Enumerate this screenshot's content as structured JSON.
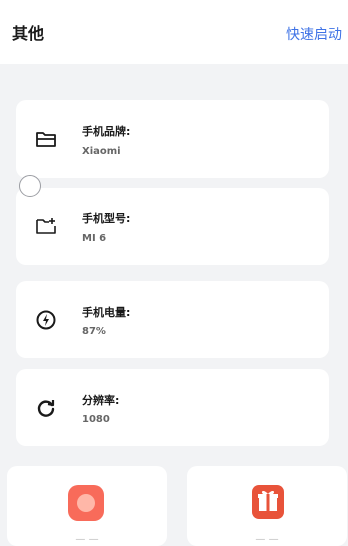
{
  "header": {
    "title": "其他",
    "action_label": "快速启动"
  },
  "cards": [
    {
      "icon": "folder-icon",
      "label": "手机品牌:",
      "value": "Xiaomi"
    },
    {
      "icon": "folder-add-icon",
      "label": "手机型号:",
      "value": "MI 6"
    },
    {
      "icon": "battery-icon",
      "label": "手机电量:",
      "value": "87%"
    },
    {
      "icon": "refresh-icon",
      "label": "分辨率:",
      "value": "1080"
    }
  ],
  "tiles": [
    {
      "icon": "record-icon",
      "color": "#f86b5a"
    },
    {
      "icon": "gift-icon",
      "color": "#e8533a"
    }
  ],
  "colors": {
    "accent": "#3f73e6",
    "background": "#f2f3f5"
  }
}
